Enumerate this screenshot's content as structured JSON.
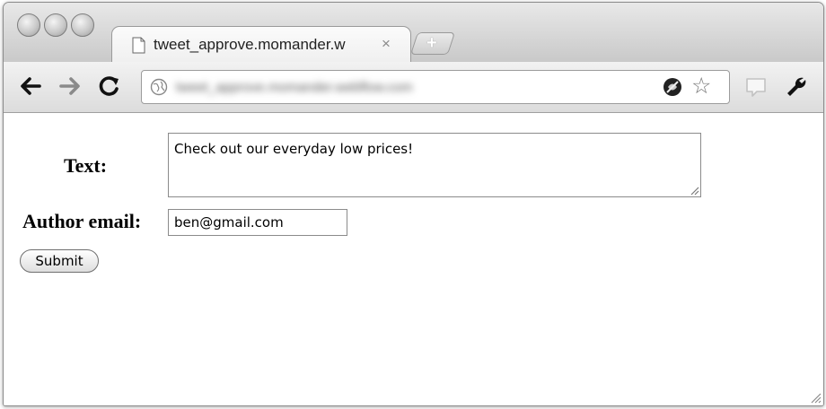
{
  "tab": {
    "title": "tweet_approve.momander.w",
    "close_label": "×",
    "new_tab_label": "+"
  },
  "toolbar": {
    "url_obscured": "tweet_approve.momander.webflow.com"
  },
  "form": {
    "text_label": "Text:",
    "text_value": "Check out our everyday low prices!",
    "email_label": "Author email:",
    "email_value": "ben@gmail.com",
    "submit_label": "Submit"
  },
  "icons": {
    "traffic_lights": [
      "close-icon",
      "minimize-icon",
      "maximize-icon"
    ],
    "tab": "document-icon",
    "nav": [
      "back-arrow-icon",
      "forward-arrow-icon",
      "reload-icon"
    ],
    "omnibox": [
      "globe-icon",
      "blocked-content-icon",
      "bookmark-star-icon"
    ],
    "extras": [
      "page-action-icon",
      "wrench-icon"
    ]
  }
}
